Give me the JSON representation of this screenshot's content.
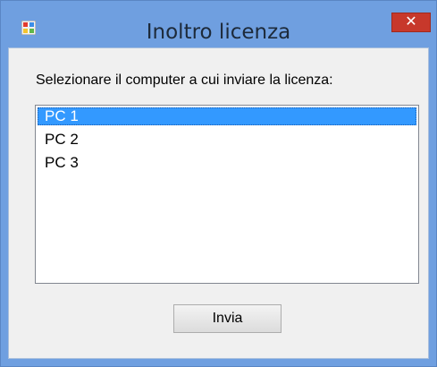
{
  "window": {
    "title": "Inoltro licenza",
    "close_symbol": "✕",
    "icon": "app-icon",
    "accent_color": "#6f9fe0",
    "close_color": "#c7382b"
  },
  "dialog": {
    "prompt": "Selezionare il computer a cui inviare la licenza:",
    "computers": [
      {
        "label": "PC 1",
        "selected": true
      },
      {
        "label": "PC 2",
        "selected": false
      },
      {
        "label": "PC 3",
        "selected": false
      }
    ],
    "send_label": "Invia",
    "selection_color": "#3399ff"
  }
}
